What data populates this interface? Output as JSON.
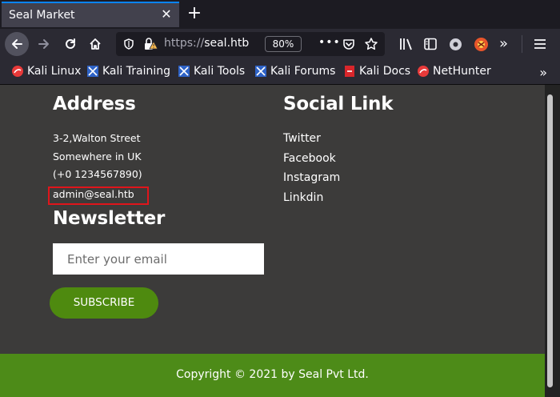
{
  "tab": {
    "title": "Seal Market"
  },
  "navbar": {
    "url_scheme": "https://",
    "url_host": "seal.htb",
    "zoom": "80%"
  },
  "bookmarks": [
    {
      "label": "Kali Linux",
      "icon": "kali-icon"
    },
    {
      "label": "Kali Training",
      "icon": "kali-training-icon"
    },
    {
      "label": "Kali Tools",
      "icon": "kali-tools-icon"
    },
    {
      "label": "Kali Forums",
      "icon": "kali-forums-icon"
    },
    {
      "label": "Kali Docs",
      "icon": "kali-docs-icon"
    },
    {
      "label": "NetHunter",
      "icon": "nethunter-icon"
    }
  ],
  "page": {
    "address": {
      "heading": "Address",
      "lines": [
        "3-2,Walton Street",
        "Somewhere in UK",
        "(+0 1234567890)",
        "admin@seal.htb"
      ]
    },
    "social": {
      "heading": "Social Link",
      "links": [
        "Twitter",
        "Facebook",
        "Instagram",
        "Linkdin"
      ]
    },
    "newsletter": {
      "heading": "Newsletter",
      "placeholder": "Enter your email",
      "button": "SUBSCRIBE"
    },
    "footer": {
      "copyright": "Copyright © 2021 by Seal Pvt Ltd."
    }
  },
  "colors": {
    "page_bg": "#3c3b3a",
    "accent_green": "#4d8b18",
    "highlight_red": "#e0151b",
    "tab_accent": "#0a84ff"
  }
}
